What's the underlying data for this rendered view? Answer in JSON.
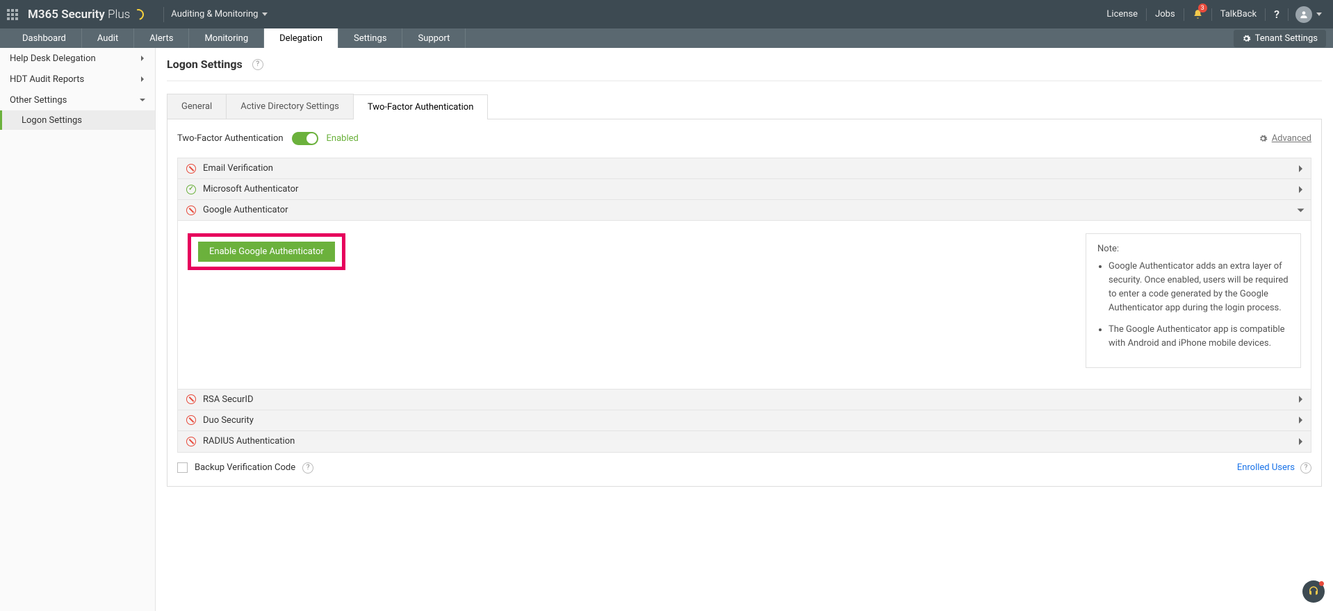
{
  "header": {
    "product": {
      "part1": "M365",
      "part2": "Security",
      "part3": "Plus"
    },
    "menu": "Auditing & Monitoring",
    "links": {
      "license": "License",
      "jobs": "Jobs",
      "talkback": "TalkBack"
    },
    "notifications": "3"
  },
  "tabs": [
    {
      "label": "Dashboard"
    },
    {
      "label": "Audit"
    },
    {
      "label": "Alerts"
    },
    {
      "label": "Monitoring"
    },
    {
      "label": "Delegation",
      "active": true
    },
    {
      "label": "Settings"
    },
    {
      "label": "Support"
    }
  ],
  "tenant_button": "Tenant Settings",
  "sidebar": [
    {
      "label": "Help Desk Delegation",
      "expandable": true
    },
    {
      "label": "HDT Audit Reports",
      "expandable": true
    },
    {
      "label": "Other Settings",
      "expanded": true
    },
    {
      "label": "Logon Settings",
      "sub": true,
      "selected": true
    }
  ],
  "page_title": "Logon Settings",
  "inner_tabs": [
    {
      "label": "General"
    },
    {
      "label": "Active Directory Settings"
    },
    {
      "label": "Two-Factor Authentication",
      "active": true
    }
  ],
  "tfa": {
    "label": "Two-Factor Authentication",
    "status": "Enabled",
    "advanced": "Advanced"
  },
  "auth_methods": [
    {
      "label": "Email Verification",
      "enabled": false
    },
    {
      "label": "Microsoft Authenticator",
      "enabled": true
    },
    {
      "label": "Google Authenticator",
      "enabled": false,
      "open": true
    },
    {
      "label": "RSA SecurID",
      "enabled": false
    },
    {
      "label": "Duo Security",
      "enabled": false
    },
    {
      "label": "RADIUS Authentication",
      "enabled": false
    }
  ],
  "google_panel": {
    "button": "Enable Google Authenticator",
    "note_title": "Note:",
    "notes": [
      "Google Authenticator adds an extra layer of security. Once enabled, users will be required to enter a code generated by the Google Authenticator app during the login process.",
      "The Google Authenticator app is compatible with Android and iPhone mobile devices."
    ]
  },
  "footer": {
    "backup": "Backup Verification Code",
    "enrolled": "Enrolled Users"
  }
}
